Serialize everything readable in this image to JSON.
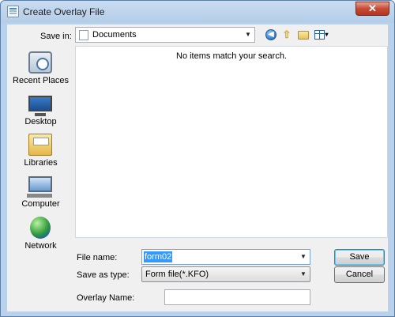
{
  "window": {
    "title": "Create Overlay File",
    "close_label": "✕"
  },
  "toolbar": {
    "save_in_label": "Save in:",
    "save_in_value": "Documents",
    "dropdown_arrow": "▼",
    "up_glyph": "⇧",
    "back_glyph": "◀",
    "views_arrow": "▾"
  },
  "places": [
    {
      "label": "Recent Places",
      "icon": "recent-places-icon"
    },
    {
      "label": "Desktop",
      "icon": "desktop-icon"
    },
    {
      "label": "Libraries",
      "icon": "libraries-icon"
    },
    {
      "label": "Computer",
      "icon": "computer-icon"
    },
    {
      "label": "Network",
      "icon": "network-icon"
    }
  ],
  "file_list": {
    "empty_message": "No items match your search."
  },
  "form": {
    "file_name_label": "File name:",
    "file_name_value": "form02",
    "save_as_type_label": "Save as type:",
    "save_as_type_value": "Form file(*.KFO)",
    "overlay_name_label": "Overlay Name:",
    "overlay_name_value": ""
  },
  "buttons": {
    "save": "Save",
    "cancel": "Cancel"
  }
}
